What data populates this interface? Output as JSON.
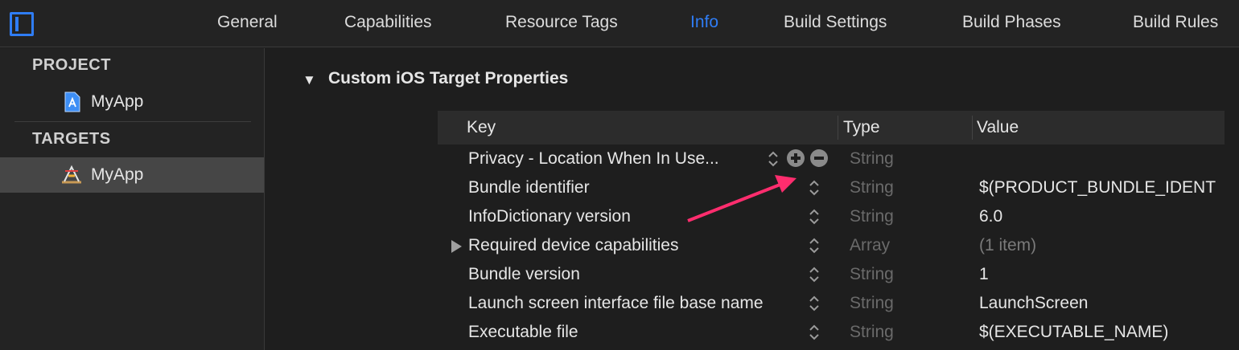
{
  "tabs": [
    {
      "label": "General",
      "active": false
    },
    {
      "label": "Capabilities",
      "active": false
    },
    {
      "label": "Resource Tags",
      "active": false
    },
    {
      "label": "Info",
      "active": true
    },
    {
      "label": "Build Settings",
      "active": false
    },
    {
      "label": "Build Phases",
      "active": false
    },
    {
      "label": "Build Rules",
      "active": false
    }
  ],
  "sidebar": {
    "project_label": "PROJECT",
    "project_item": "MyApp",
    "targets_label": "TARGETS",
    "target_item": "MyApp"
  },
  "main": {
    "section_title": "Custom iOS Target Properties",
    "columns": {
      "key": "Key",
      "type": "Type",
      "value": "Value"
    },
    "rows": [
      {
        "key": "Privacy - Location When In Use...",
        "type": "String",
        "value": ""
      },
      {
        "key": "Bundle identifier",
        "type": "String",
        "value": "$(PRODUCT_BUNDLE_IDENT"
      },
      {
        "key": "InfoDictionary version",
        "type": "String",
        "value": "6.0"
      },
      {
        "key": "Required device capabilities",
        "type": "Array",
        "value": "(1 item)"
      },
      {
        "key": "Bundle version",
        "type": "String",
        "value": "1"
      },
      {
        "key": "Launch screen interface file base name",
        "type": "String",
        "value": "LaunchScreen"
      },
      {
        "key": "Executable file",
        "type": "String",
        "value": "$(EXECUTABLE_NAME)"
      }
    ]
  },
  "colors": {
    "accent": "#2f7df6",
    "annotation_arrow": "#ff2d6e"
  },
  "icons": [
    "sidebar-toggle-icon",
    "project-file-icon",
    "app-target-icon",
    "disclosure-triangle-icon",
    "stepper-icon",
    "add-row-icon",
    "remove-row-icon"
  ]
}
